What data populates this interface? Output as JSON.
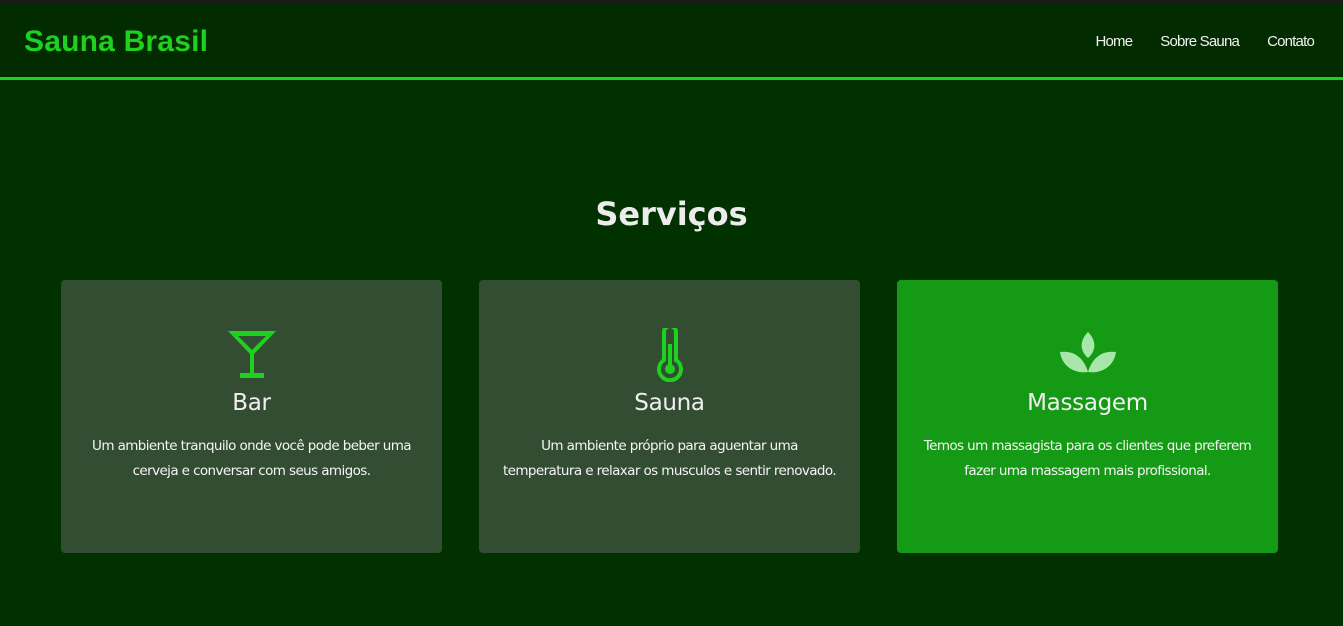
{
  "header": {
    "brand": "Sauna Brasil",
    "nav": [
      "Home",
      "Sobre Sauna",
      "Contato"
    ]
  },
  "main": {
    "title": "Serviços",
    "services": [
      {
        "icon": "cocktail-icon",
        "title": "Bar",
        "description": "Um ambiente tranquilo onde você pode beber uma cerveja e conversar com seus amigos."
      },
      {
        "icon": "thermometer-icon",
        "title": "Sauna",
        "description": "Um ambiente próprio para aguentar uma temperatura e relaxar os musculos e sentir renovado."
      },
      {
        "icon": "lotus-icon",
        "title": "Massagem",
        "description": "Temos um massagista para os clientes que preferem fazer uma massagem mais profissional."
      }
    ]
  },
  "colors": {
    "background": "#023100",
    "accent": "#1fd11f",
    "card": "#334d33",
    "card_highlight": "#149a14"
  }
}
